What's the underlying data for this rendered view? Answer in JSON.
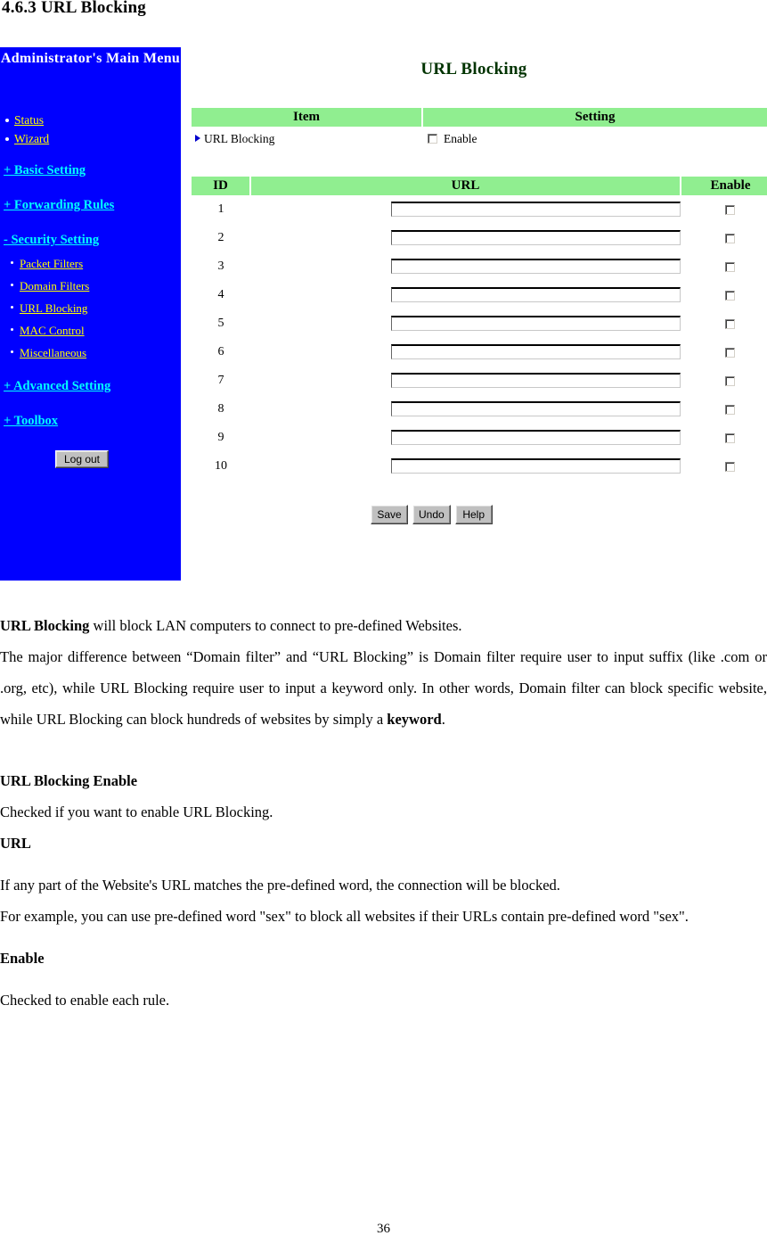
{
  "section": {
    "heading": "4.6.3 URL Blocking"
  },
  "sidebar": {
    "title": "Administrator's Main Menu",
    "top_links": [
      {
        "label": "Status"
      },
      {
        "label": "Wizard"
      }
    ],
    "groups": [
      {
        "label": "+ Basic Setting"
      },
      {
        "label": "+ Forwarding Rules"
      },
      {
        "label": "- Security Setting"
      },
      {
        "label": "+ Advanced Setting"
      },
      {
        "label": "+ Toolbox"
      }
    ],
    "security_sub_links": [
      {
        "label": "Packet Filters"
      },
      {
        "label": "Domain Filters"
      },
      {
        "label": "URL Blocking"
      },
      {
        "label": "MAC Control"
      },
      {
        "label": "Miscellaneous"
      }
    ],
    "logout_label": "Log out",
    "background_color": "#0000ff",
    "link_color": "#ffff00",
    "group_link_color": "#00ffff"
  },
  "panel": {
    "title": "URL Blocking",
    "title_color": "#003300",
    "header_color": "#90ee90",
    "setting_table": {
      "columns": [
        "Item",
        "Setting"
      ],
      "rows": [
        {
          "item": "URL Blocking",
          "setting_label": "Enable",
          "checked": false
        }
      ]
    },
    "rules_table": {
      "columns": [
        "ID",
        "URL",
        "Enable"
      ],
      "rows": [
        {
          "id": "1",
          "url": "",
          "enabled": false
        },
        {
          "id": "2",
          "url": "",
          "enabled": false
        },
        {
          "id": "3",
          "url": "",
          "enabled": false
        },
        {
          "id": "4",
          "url": "",
          "enabled": false
        },
        {
          "id": "5",
          "url": "",
          "enabled": false
        },
        {
          "id": "6",
          "url": "",
          "enabled": false
        },
        {
          "id": "7",
          "url": "",
          "enabled": false
        },
        {
          "id": "8",
          "url": "",
          "enabled": false
        },
        {
          "id": "9",
          "url": "",
          "enabled": false
        },
        {
          "id": "10",
          "url": "",
          "enabled": false
        }
      ]
    },
    "buttons": [
      {
        "label": "Save"
      },
      {
        "label": "Undo"
      },
      {
        "label": "Help"
      }
    ]
  },
  "body": {
    "p1_bold": "URL Blocking",
    "p1_rest": " will block LAN computers to connect to pre-defined Websites.",
    "p2": "The major difference between “Domain filter” and “URL Blocking” is Domain filter require user to input suffix (like .com or .org, etc), while URL Blocking require user to input a keyword only. In other words, Domain filter can block specific website, while URL Blocking can block hundreds of websites by simply a ",
    "p2_bold": "keyword",
    "p2_tail": ".",
    "head1": "URL Blocking Enable",
    "p3": "Checked if you want to enable URL Blocking.",
    "head2": "URL",
    "p4": "If any part of the Website's URL matches the pre-defined word, the connection will be blocked.",
    "p5": "For example, you can use pre-defined word \"sex\" to block all websites if their URLs contain pre-defined word \"sex\".",
    "head3": "Enable",
    "p6": "Checked to enable each rule."
  },
  "footer": {
    "page_number": "36"
  }
}
